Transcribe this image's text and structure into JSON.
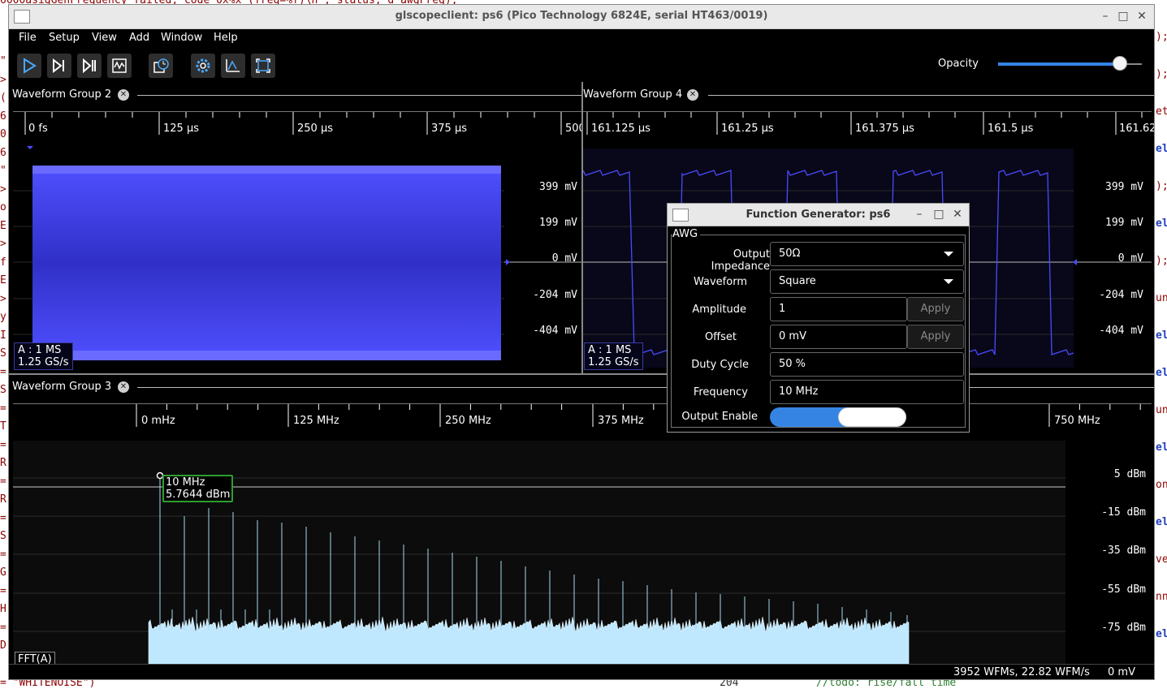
{
  "window": {
    "title": "glscopeclient: ps6 (Pico Technology 6824E, serial HT463/0019)"
  },
  "menu": [
    "File",
    "Setup",
    "View",
    "Add",
    "Window",
    "Help"
  ],
  "toolbar": {
    "opacity_label": "Opacity",
    "opacity_value": 0.85
  },
  "group2": {
    "name": "Waveform Group 2",
    "ticks": [
      "0 fs",
      "125 µs",
      "250 µs",
      "375 µs",
      "500"
    ],
    "volts": [
      "399 mV",
      "199 mV",
      "0 mV",
      "-204 mV",
      "-404 mV"
    ],
    "info": [
      "A : 1 MS",
      "1.25 GS/s"
    ]
  },
  "group4": {
    "name": "Waveform Group 4",
    "ticks": [
      "161.125 µs",
      "161.25 µs",
      "161.375 µs",
      "161.5 µs",
      "161.62"
    ],
    "volts": [
      "399 mV",
      "199 mV",
      "0 mV",
      "-204 mV",
      "-404 mV"
    ],
    "info": [
      "A : 1 MS",
      "1.25 GS/s"
    ]
  },
  "group3": {
    "name": "Waveform Group 3",
    "ticks": [
      "0 mHz",
      "125 MHz",
      "250 MHz",
      "375 MHz",
      "750 MHz"
    ],
    "levels": [
      "5 dBm",
      "-15 dBm",
      "-35 dBm",
      "-55 dBm",
      "-75 dBm"
    ],
    "cursor": [
      "10 MHz",
      "5.7644 dBm"
    ],
    "channel": "FFT(A)"
  },
  "statusbar": {
    "wfms": "3952 WFMs, 22.82 WFM/s",
    "volts": "0 mV"
  },
  "dialog": {
    "title": "Function Generator: ps6",
    "frame": "AWG",
    "labels": [
      "Output Impedance",
      "Waveform",
      "Amplitude",
      "Offset",
      "Duty Cycle",
      "Frequency",
      "Output Enable"
    ],
    "impedance": "50Ω",
    "waveform": "Square",
    "amplitude": "1",
    "offset": "0 mV",
    "duty": "50 %",
    "frequency": "10 MHz",
    "apply": "Apply"
  },
  "bgcode": {
    "top": "6000asigGenFrequency failed, code 0x%x (freq=%f)\\n\", status, d_awgFreq);",
    "bottom": "= \"WHITENOISE\")",
    "bottom_mid": "204",
    "bottom_right": "//todo: rise/fall time",
    "right_lines": [
      ");",
      ");",
      "et",
      "el",
      ");",
      "el",
      ");",
      "un",
      "el",
      "el",
      "un",
      "el",
      "on",
      "el",
      "ve",
      "nn",
      "el"
    ],
    "left_lines": [
      "\"",
      ">",
      "(",
      "6",
      "0",
      "6",
      "\"",
      ">",
      "o",
      "E",
      ">",
      "f",
      "E",
      ">",
      "y",
      "I",
      "S",
      "=",
      "S",
      "=",
      "T",
      "=",
      "R",
      "=",
      "R",
      "=",
      "S",
      "=",
      "G",
      "=",
      "H",
      "=",
      "D"
    ]
  },
  "colors": {
    "waveform": "#4a4aff",
    "spectrum": "#bfe8ff",
    "cursor": "#2e9e2e"
  }
}
